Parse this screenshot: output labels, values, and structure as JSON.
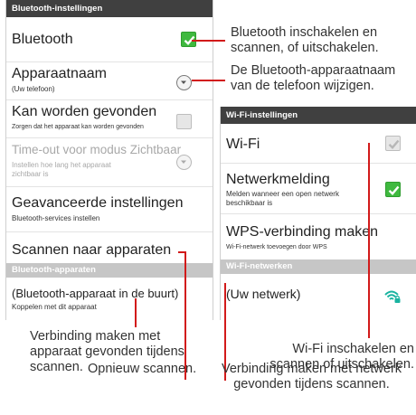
{
  "bluetooth_screen": {
    "header": "Bluetooth-instellingen",
    "items": [
      {
        "title": "Bluetooth",
        "subtitle": "",
        "control": "checkbox-on"
      },
      {
        "title": "Apparaatnaam",
        "subtitle": "(Uw telefoon)",
        "control": "dropdown"
      },
      {
        "title": "Kan worden gevonden",
        "subtitle": "Zorgen dat het apparaat kan worden gevonden",
        "control": "checkbox-off"
      },
      {
        "title": "Time-out voor modus Zichtbaar",
        "subtitle": "Instellen hoe lang het apparaat zichtbaar is",
        "control": "dropdown-disabled"
      },
      {
        "title": "Geavanceerde instellingen",
        "subtitle": "Bluetooth-services instellen",
        "control": "none"
      },
      {
        "title": "Scannen naar apparaten",
        "subtitle": "",
        "control": "none"
      }
    ],
    "devices_header": "Bluetooth-apparaten",
    "device": {
      "title": "(Bluetooth-apparaat in de buurt)",
      "subtitle": "Koppelen met dit apparaat"
    }
  },
  "wifi_screen": {
    "header": "Wi-Fi-instellingen",
    "items": [
      {
        "title": "Wi-Fi",
        "subtitle": "",
        "control": "checkbox-off"
      },
      {
        "title": "Netwerkmelding",
        "subtitle": "Melden wanneer een open netwerk beschikbaar is",
        "control": "checkbox-on"
      },
      {
        "title": "WPS-verbinding maken",
        "subtitle": "Wi-Fi-netwerk toevoegen door WPS",
        "control": "none"
      }
    ],
    "networks_header": "Wi-Fi-netwerken",
    "network": {
      "title": "(Uw netwerk)",
      "icon": "wifi-lock-icon"
    }
  },
  "callouts": {
    "bt_toggle": "Bluetooth inschakelen en scannen, of uitschakelen.",
    "bt_name": "De Bluetooth-apparaatnaam van de telefoon wijzigen.",
    "bt_connect": "Verbinding maken met apparaat gevonden tijdens scannen.",
    "bt_rescan": "Opnieuw scannen.",
    "wifi_toggle": "Wi-Fi inschakelen en scannen of uitschakelen.",
    "wifi_connect": "Verbinding maken met netwerk gevonden tijdens scannen."
  },
  "colors": {
    "accent_red": "#d21a1a",
    "check_green": "#3fb93f",
    "header_dark": "#404040",
    "wifi_teal": "#19b3a0"
  }
}
